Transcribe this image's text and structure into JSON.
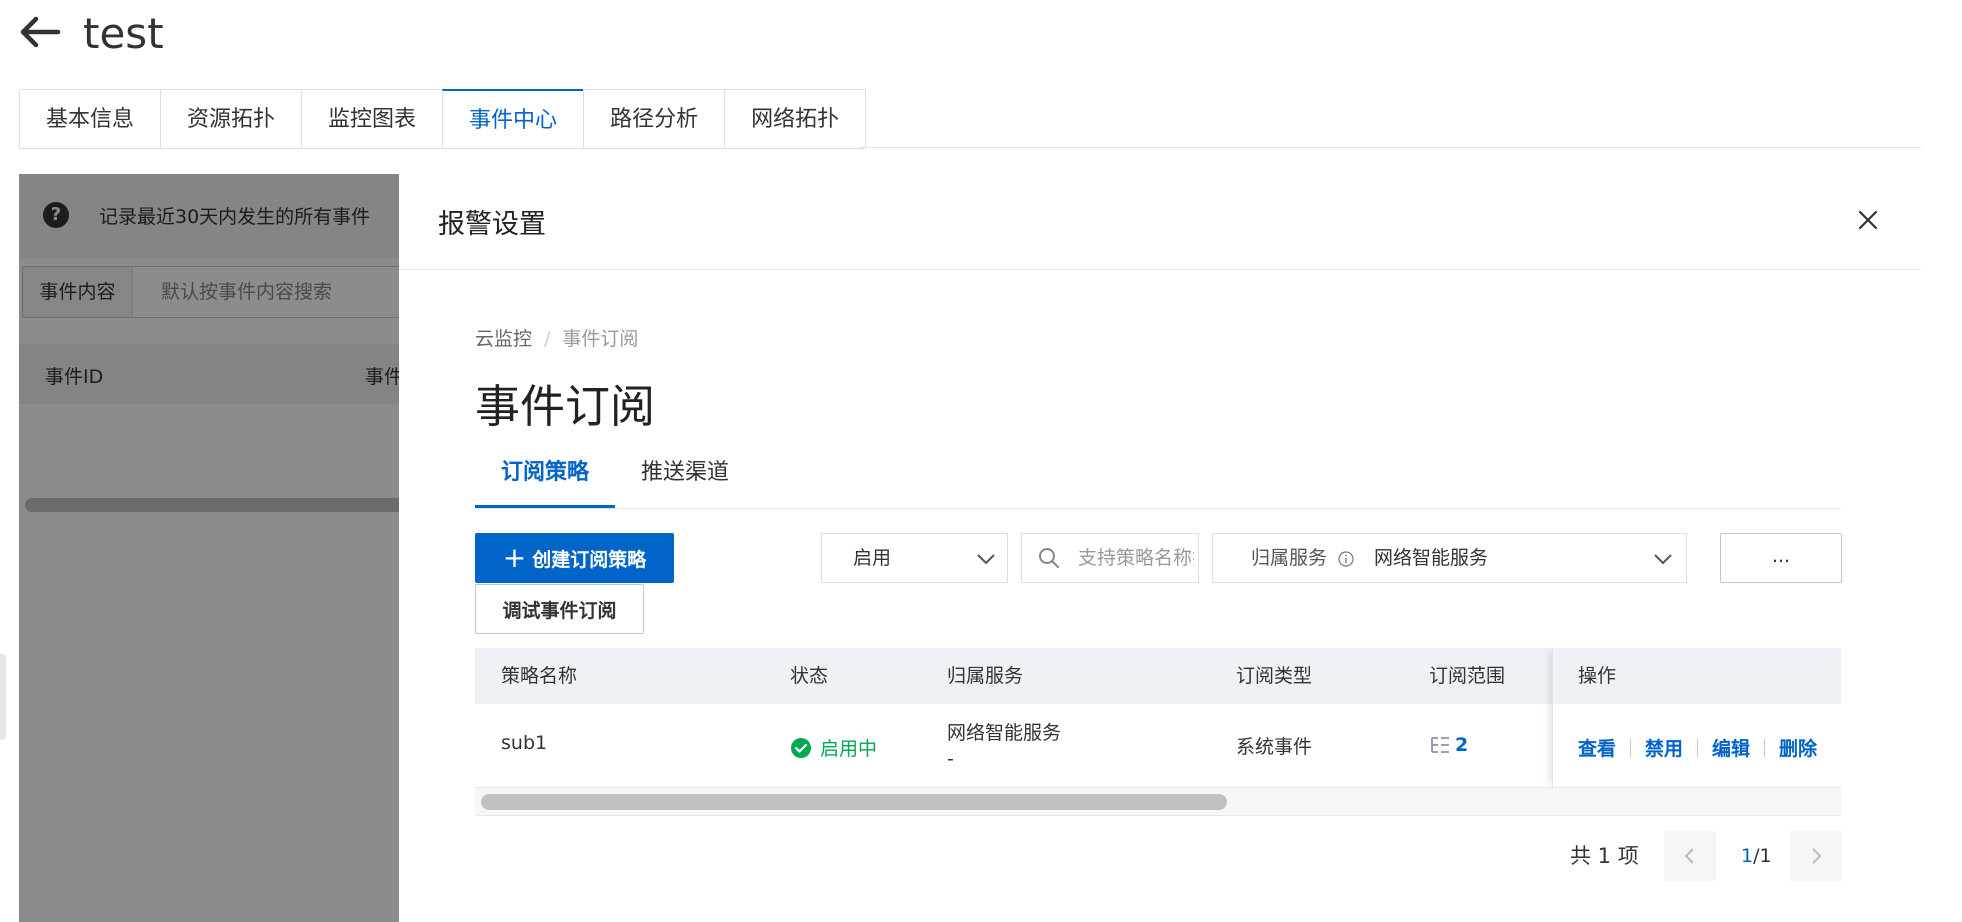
{
  "header": {
    "title": "test"
  },
  "tabs": [
    {
      "label": "基本信息"
    },
    {
      "label": "资源拓扑"
    },
    {
      "label": "监控图表"
    },
    {
      "label": "事件中心"
    },
    {
      "label": "路径分析"
    },
    {
      "label": "网络拓扑"
    }
  ],
  "active_tab": "事件中心",
  "background": {
    "notice": "记录最近30天内发生的所有事件",
    "search_label": "事件内容",
    "search_placeholder": "默认按事件内容搜索",
    "columns": [
      "事件ID",
      "事件"
    ]
  },
  "drawer": {
    "title": "报警设置",
    "breadcrumb": [
      "云监控",
      "事件订阅"
    ],
    "subtitle": "事件订阅",
    "tabs": [
      {
        "label": "订阅策略"
      },
      {
        "label": "推送渠道"
      }
    ],
    "toolbar": {
      "create_label": "创建订阅策略",
      "debug_label": "调试事件订阅",
      "status_select": "启用",
      "search_placeholder": "支持策略名称搜索",
      "service_label": "归属服务",
      "service_value": "网络智能服务",
      "more_label": "..."
    },
    "table": {
      "columns": [
        "策略名称",
        "状态",
        "归属服务",
        "订阅类型",
        "订阅范围",
        "操作"
      ],
      "rows": [
        {
          "name": "sub1",
          "status": "启用中",
          "service": "网络智能服务",
          "service_sub": "-",
          "type": "系统事件",
          "scope": "2",
          "actions": [
            "查看",
            "禁用",
            "编辑",
            "删除"
          ]
        }
      ]
    },
    "pagination": {
      "total": "共 1 项",
      "current": "1",
      "pages": "/1"
    }
  },
  "colors": {
    "primary": "#0064c8",
    "success": "#00a854",
    "mask": "rgba(0,0,0,0.45)"
  }
}
